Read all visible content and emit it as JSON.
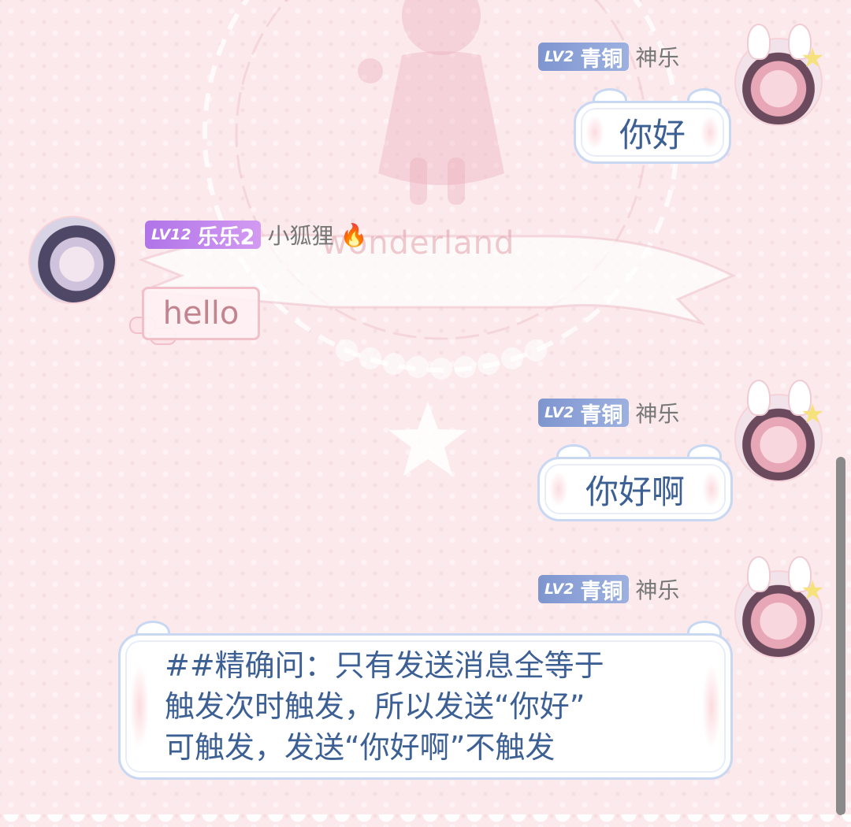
{
  "messages": [
    {
      "side": "right",
      "badge_level": "LV2",
      "badge_title": "青铜",
      "nickname": "神乐",
      "text": "你好"
    },
    {
      "side": "left",
      "badge_level": "LV12",
      "badge_title": "乐乐2",
      "nickname": "小狐狸",
      "nickname_icon": "fire-icon",
      "nickname_emoji": "🔥",
      "text": "hello"
    },
    {
      "side": "right",
      "badge_level": "LV2",
      "badge_title": "青铜",
      "nickname": "神乐",
      "text": "你好啊"
    },
    {
      "side": "right",
      "badge_level": "LV2",
      "badge_title": "青铜",
      "nickname": "神乐",
      "text": "##精确问：只有发送消息全等于\n触发次时触发，所以发送“你好”\n可触发，发送“你好啊”不触发"
    }
  ],
  "background": {
    "watermark_text": "wonderland",
    "colors": {
      "base": "#fbe9ec",
      "bubble_border_blue": "#c8d7f2",
      "text_blue": "#3c5f94",
      "bubble_border_pink": "#f1c0c9",
      "text_pink": "#c2848f"
    }
  }
}
